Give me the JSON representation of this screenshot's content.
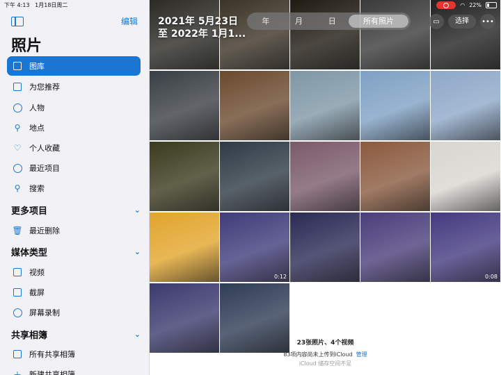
{
  "status": {
    "time": "下午 4:13",
    "date": "1月18日周二",
    "battery": "22%"
  },
  "sidebar": {
    "edit_label": "编辑",
    "title": "照片",
    "library_items": [
      {
        "label": "图库",
        "icon": "photo-library-icon"
      },
      {
        "label": "为您推荐",
        "icon": "for-you-icon"
      },
      {
        "label": "人物",
        "icon": "people-icon"
      },
      {
        "label": "地点",
        "icon": "places-icon"
      },
      {
        "label": "个人收藏",
        "icon": "heart-icon"
      },
      {
        "label": "最近项目",
        "icon": "clock-icon"
      },
      {
        "label": "搜索",
        "icon": "search-icon"
      }
    ],
    "more_section": "更多项目",
    "more_items": [
      {
        "label": "最近删除",
        "icon": "trash-icon"
      }
    ],
    "media_section": "媒体类型",
    "media_items": [
      {
        "label": "视频",
        "icon": "video-icon"
      },
      {
        "label": "截屏",
        "icon": "screenshot-icon"
      },
      {
        "label": "屏幕录制",
        "icon": "screen-record-icon"
      }
    ],
    "shared_section": "共享相簿",
    "shared_items": [
      {
        "label": "所有共享相簿",
        "icon": "shared-album-icon"
      },
      {
        "label": "新建共享相簿",
        "icon": "add-icon"
      }
    ]
  },
  "main": {
    "date_range_line1": "2021年 5月23日",
    "date_range_line2": "至 2022年 1月1...",
    "segments": [
      "年",
      "月",
      "日",
      "所有照片"
    ],
    "select_label": "选择",
    "colors": {
      "accent": "#1a76d2"
    },
    "thumbnails": [
      {
        "kind": "photo",
        "duration": ""
      },
      {
        "kind": "photo",
        "duration": ""
      },
      {
        "kind": "photo",
        "duration": ""
      },
      {
        "kind": "photo",
        "duration": ""
      },
      {
        "kind": "photo",
        "duration": ""
      },
      {
        "kind": "photo",
        "duration": ""
      },
      {
        "kind": "photo",
        "duration": ""
      },
      {
        "kind": "photo",
        "duration": ""
      },
      {
        "kind": "photo",
        "duration": ""
      },
      {
        "kind": "photo",
        "duration": ""
      },
      {
        "kind": "photo",
        "duration": ""
      },
      {
        "kind": "photo",
        "duration": ""
      },
      {
        "kind": "photo",
        "duration": ""
      },
      {
        "kind": "photo",
        "duration": ""
      },
      {
        "kind": "photo",
        "duration": ""
      },
      {
        "kind": "photo",
        "duration": ""
      },
      {
        "kind": "video",
        "duration": "0:12"
      },
      {
        "kind": "photo",
        "duration": ""
      },
      {
        "kind": "photo",
        "duration": ""
      },
      {
        "kind": "video",
        "duration": "0:08"
      },
      {
        "kind": "photo",
        "duration": ""
      },
      {
        "kind": "photo",
        "duration": ""
      }
    ],
    "summary": "23张照片、4个视频",
    "icloud_note": "83项内容尚未上传到iCloud",
    "icloud_manage": "管理",
    "icloud_storage": "iCloud 储存空间不足"
  }
}
